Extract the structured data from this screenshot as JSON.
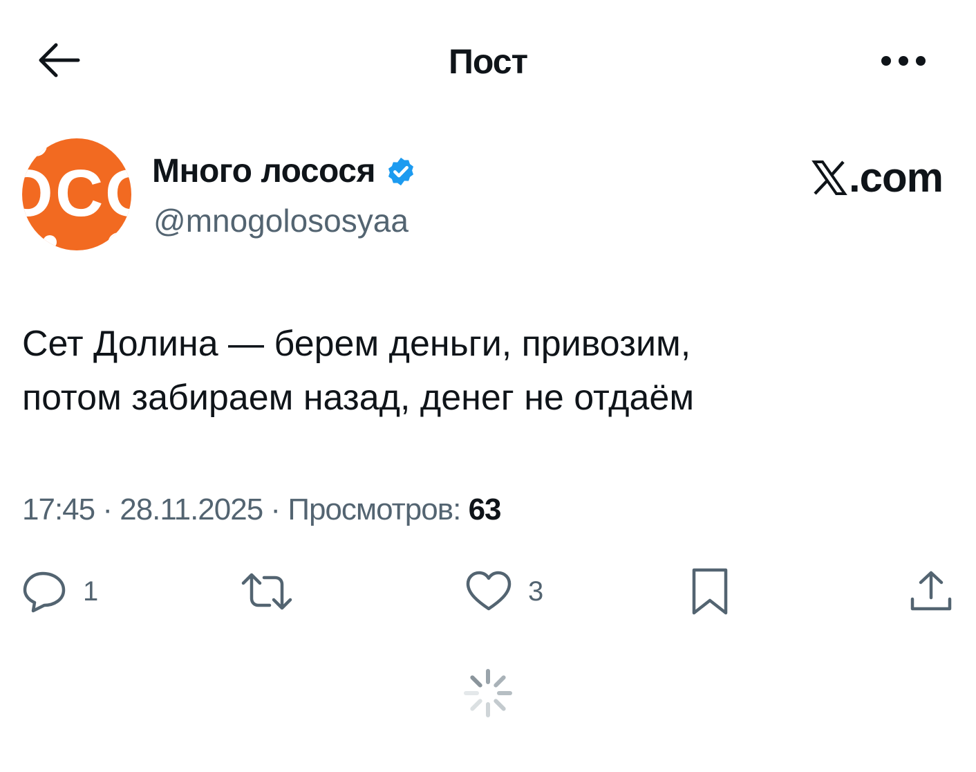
{
  "header": {
    "title": "Пост",
    "back_icon": "arrow-left-icon",
    "more_icon": "more-horizontal-icon"
  },
  "author": {
    "display_name": "Много лосося",
    "handle": "@mnogolososyaa",
    "verified": true,
    "avatar_colors": {
      "background": "#f26a21",
      "text": "#ffffff"
    },
    "avatar_text": "OCO"
  },
  "site_mark": {
    "text": ".com",
    "logo_letter": "X"
  },
  "post": {
    "line1": "Сет Долина — берем деньги, привозим,",
    "line2": "потом забираем назад, денег не отдаём"
  },
  "meta": {
    "time": "17:45",
    "date": "28.11.2025",
    "views_label": "Просмотров:",
    "views_count": "63",
    "separator": "·"
  },
  "actions": {
    "reply_count": "1",
    "retweet_count": "",
    "like_count": "3",
    "icons": [
      "reply-icon",
      "retweet-icon",
      "like-icon",
      "bookmark-icon",
      "share-icon"
    ]
  },
  "colors": {
    "text_primary": "#0f1419",
    "text_secondary": "#536471",
    "verified_blue": "#1d9bf0",
    "avatar_orange": "#f26a21"
  }
}
